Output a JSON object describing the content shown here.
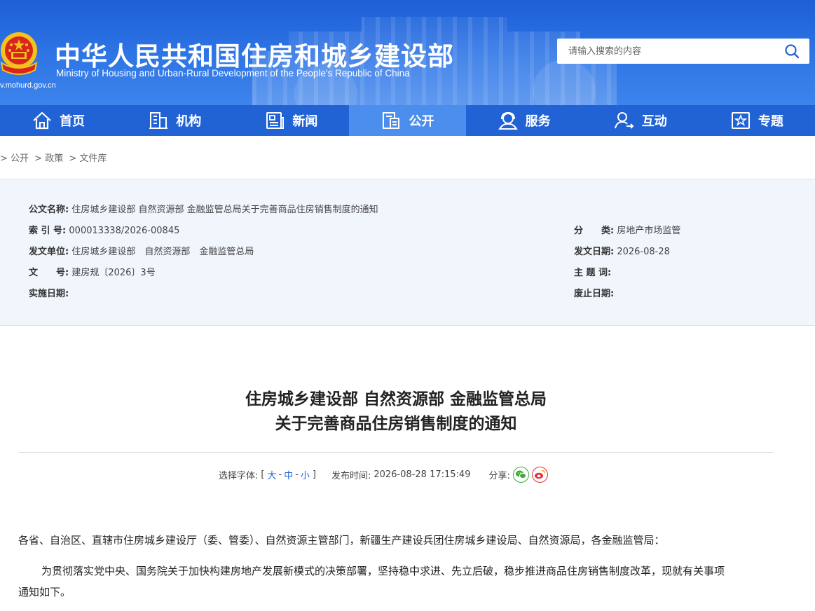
{
  "header": {
    "title": "中华人民共和国住房和城乡建设部",
    "subtitle": "Ministry of Housing and Urban-Rural Development of the People's Republic of China",
    "domain": "v.mohurd.gov.cn",
    "brand_color": "#2163d5"
  },
  "search": {
    "placeholder": "请输入搜索的内容",
    "icon": "search-icon"
  },
  "nav": {
    "items": [
      {
        "label": "首页",
        "icon": "home-icon"
      },
      {
        "label": "机构",
        "icon": "building-icon"
      },
      {
        "label": "新闻",
        "icon": "news-icon"
      },
      {
        "label": "公开",
        "icon": "document-icon",
        "active": true
      },
      {
        "label": "服务",
        "icon": "service-icon"
      },
      {
        "label": "互动",
        "icon": "interact-icon"
      },
      {
        "label": "专题",
        "icon": "topic-icon"
      }
    ]
  },
  "breadcrumb": {
    "items": [
      "> 公开",
      "> 政策",
      "> 文件库"
    ]
  },
  "meta": {
    "name_label": "公文名称:",
    "name_value": "住房城乡建设部 自然资源部 金融监管总局关于完善商品住房销售制度的通知",
    "index_label": "索 引 号:",
    "index_value": "000013338/2026-00845",
    "category_label": "分　　类:",
    "category_value": "房地产市场监管",
    "issuer_label": "发文单位:",
    "issuer_value": "住房城乡建设部　自然资源部　金融监管总局",
    "date_label": "发文日期:",
    "date_value": "2026-08-28",
    "docno_label": "文　　号:",
    "docno_value": "建房规〔2026〕3号",
    "keywords_label": "主 题 词:",
    "keywords_value": "",
    "effective_label": "实施日期:",
    "effective_value": "",
    "abolish_label": "废止日期:",
    "abolish_value": ""
  },
  "article": {
    "title_line1": "住房城乡建设部 自然资源部 金融监管总局",
    "title_line2": "关于完善商品住房销售制度的通知",
    "font_label": "选择字体:",
    "bracket_open": "[",
    "size_large": "大",
    "size_medium": "中",
    "size_small": "小",
    "sep": "-",
    "bracket_close": "]",
    "publish_label": "发布时间:",
    "publish_time": "2026-08-28 17:15:49",
    "share_label": "分享:",
    "salutation": "各省、自治区、直辖市住房城乡建设厅（委、管委）、自然资源主管部门，新疆生产建设兵团住房城乡建设局、自然资源局，各金融监管局：",
    "para1_line1": "为贯彻落实党中央、国务院关于加快构建房地产发展新模式的决策部署，坚持稳中求进、先立后破，稳步推进商品住房销售制度改革，现就有关事项",
    "para1_line2": "通知如下。"
  }
}
